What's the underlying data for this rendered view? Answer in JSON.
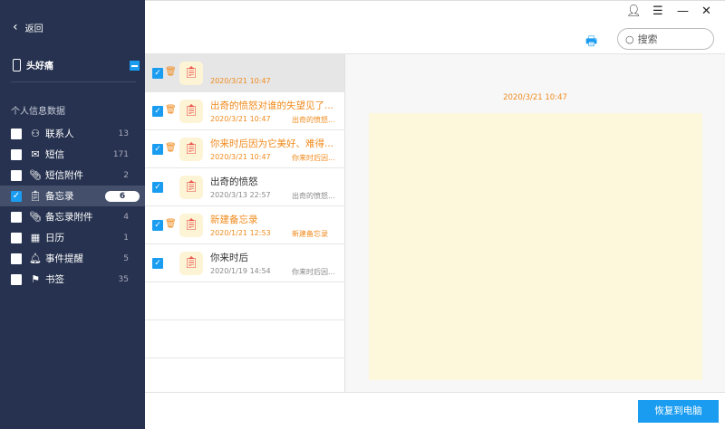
{
  "sidebar": {
    "back_label": "返回",
    "device_name": "头好痛",
    "section_title": "个人信息数据",
    "items": [
      {
        "label": "联系人",
        "count": "13",
        "icon": "person-icon",
        "checked": false
      },
      {
        "label": "短信",
        "count": "171",
        "icon": "envelope-icon",
        "checked": false
      },
      {
        "label": "短信附件",
        "count": "2",
        "icon": "paperclip-icon",
        "checked": false
      },
      {
        "label": "备忘录",
        "count": "6",
        "icon": "clipboard-icon",
        "checked": true
      },
      {
        "label": "备忘录附件",
        "count": "4",
        "icon": "paperclip-icon",
        "checked": false
      },
      {
        "label": "日历",
        "count": "1",
        "icon": "calendar-icon",
        "checked": false
      },
      {
        "label": "事件提醒",
        "count": "5",
        "icon": "bell-icon",
        "checked": false
      },
      {
        "label": "书签",
        "count": "35",
        "icon": "bookmark-icon",
        "checked": false
      }
    ]
  },
  "header": {
    "search_placeholder": "搜索"
  },
  "list": [
    {
      "title": "",
      "date": "2020/3/21 10:47",
      "preview": "",
      "highlight": true,
      "trash": true
    },
    {
      "title": "出奇的愤怒对谁的失望见了...",
      "date": "2020/3/21 10:47",
      "preview": "出奇的愤怒...",
      "highlight": true,
      "trash": true
    },
    {
      "title": "你来时后因为它美好、难得...",
      "date": "2020/3/21 10:47",
      "preview": "你来时后因...",
      "highlight": true,
      "trash": true
    },
    {
      "title": "出奇的愤怒",
      "date": "2020/3/13 22:57",
      "preview": "出奇的愤怒...",
      "highlight": false,
      "trash": false
    },
    {
      "title": "新建备忘录",
      "date": "2020/1/21 12:53",
      "preview": "新建备忘录",
      "highlight": true,
      "trash": true
    },
    {
      "title": "你来时后",
      "date": "2020/1/19 14:54",
      "preview": "你来时后因...",
      "highlight": false,
      "trash": false
    }
  ],
  "detail": {
    "date": "2020/3/21 10:47"
  },
  "footer": {
    "restore_label": "恢复到电脑"
  },
  "colors": {
    "sidebar": "#26324f",
    "accent": "#1a9cf0",
    "highlight": "#f08a1c",
    "note_bg": "#fdf8dc"
  }
}
